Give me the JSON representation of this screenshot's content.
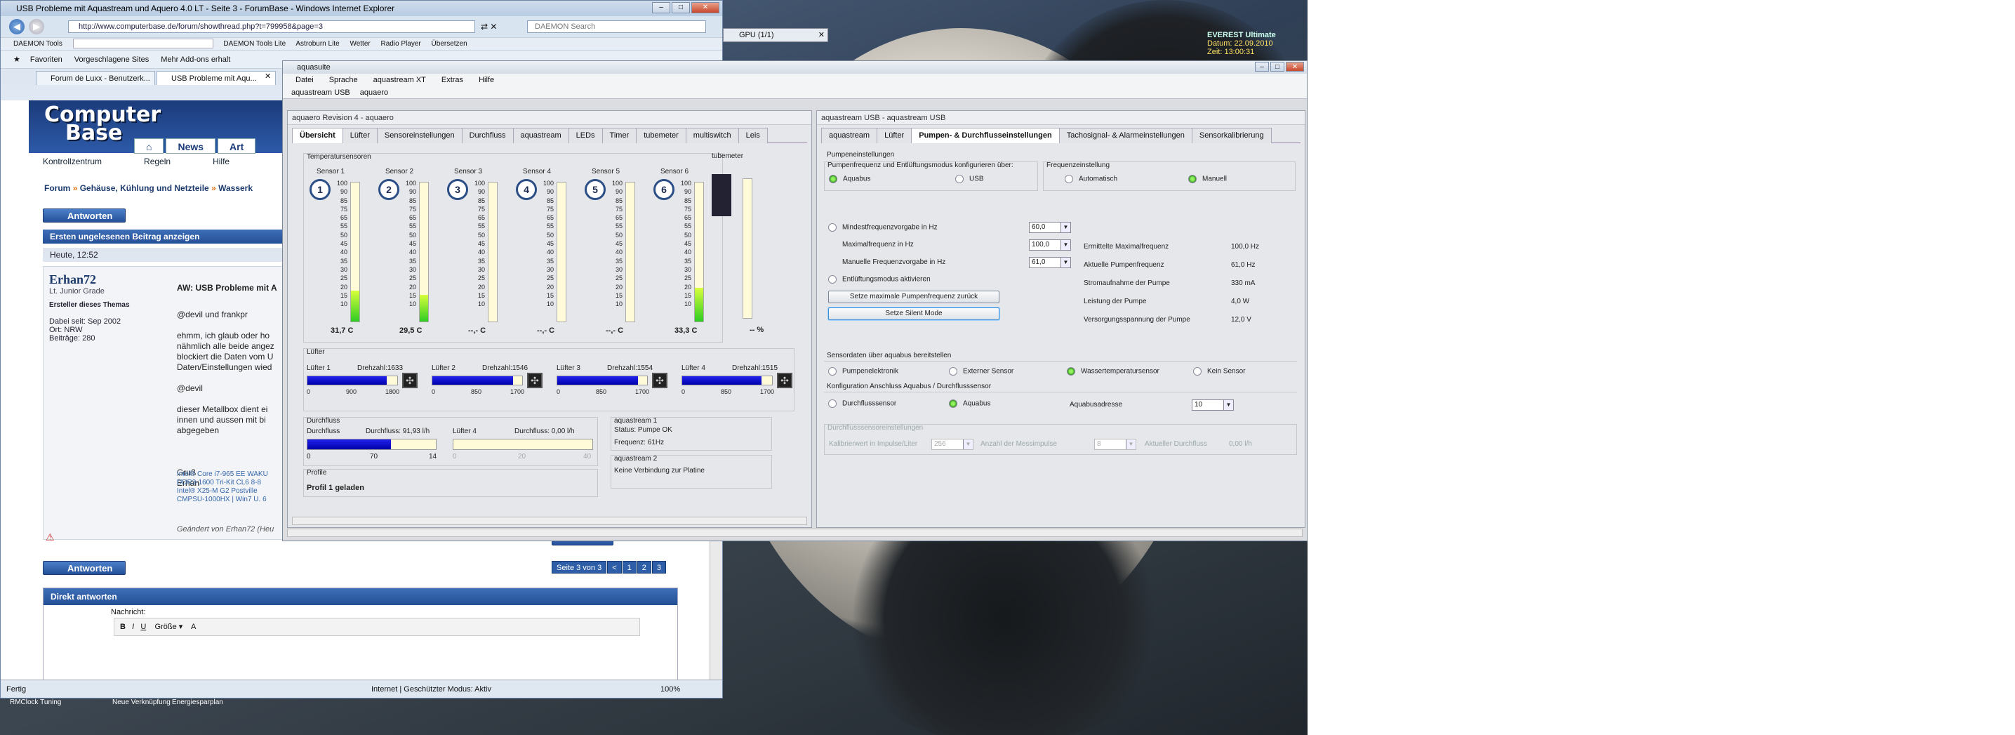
{
  "desktop": {
    "everest": {
      "title": "EVEREST Ultimate",
      "date": "Datum: 22.09.2010",
      "time": "Zeit: 13:00:31"
    },
    "icons": [
      "RMClock Tuning",
      "Neue Verknüpfung",
      "Energiesparplan"
    ]
  },
  "ie": {
    "title": "USB Probleme mit Aquastream und Aquero 4.0 LT - Seite 3 - ForumBase - Windows Internet Explorer",
    "url": "http://www.computerbase.de/forum/showthread.php?t=799958&page=3",
    "search_placeholder": "DAEMON Search",
    "toolbar": [
      "DAEMON Tools",
      "DAEMON Tools Lite",
      "Astroburn Lite",
      "Wetter",
      "Radio Player",
      "Übersetzen"
    ],
    "favorites": [
      "Favoriten",
      "Vorgeschlagene Sites",
      "Mehr Add-ons erhalt"
    ],
    "tabs": [
      "Forum de Luxx - Benutzerk...",
      "USB Probleme mit Aqu..."
    ],
    "status_left": "Fertig",
    "status_zone": "Internet | Geschützter Modus: Aktiv",
    "zoom": "100%"
  },
  "forum": {
    "logo_line1": "Computer",
    "logo_line2": "Base",
    "nav": [
      "News",
      "Art"
    ],
    "subnav": [
      "Kontrollzentrum",
      "Regeln",
      "Hilfe"
    ],
    "breadcrumb_a": "Forum",
    "breadcrumb_b": "Gehäuse, Kühlung und Netzteile",
    "breadcrumb_c": "Wasserk",
    "reply_btn": "Antworten",
    "first_unread": "Ersten ungelesenen Beitrag anzeigen",
    "post_time": "Heute, 12:52",
    "user": {
      "name": "Erhan72",
      "rank": "Lt. Junior Grade",
      "role": "Ersteller dieses Themas",
      "since": "Dabei seit: Sep 2002",
      "place": "Ort: NRW",
      "posts": "Beiträge: 280"
    },
    "post_title": "AW: USB Probleme mit A",
    "post_body": "@devil und frankpr\n\nehmm, ich glaub oder ho\nnähmlich alle beide angez\nblockiert die Daten vom U\nDaten/Einstellungen wied\n\n@devil\n\ndieser Metallbox dient ei\ninnen und aussen mit bi\nabgegeben",
    "greet": "Gruß\nErhan",
    "signature": "Intel® Core i7-965 EE WAKU\nDDR3-1600 Tri-Kit CL6 8-8\n Intel® X25-M G2 Postville\nCMPSU-1000HX | Win7 U. 6",
    "edited": "Geändert von Erhan72 (Heu",
    "page_info": "Seite 3 von 3",
    "pages": [
      "<",
      "1",
      "2",
      "3"
    ],
    "antwort": "Antwort",
    "direct_reply": "Direkt antworten",
    "message_label": "Nachricht:",
    "size_label": "Größe"
  },
  "aq": {
    "title": "aquasuite",
    "menu": [
      "Datei",
      "Sprache",
      "aquastream XT",
      "Extras",
      "Hilfe"
    ],
    "devices": [
      "aquastream USB",
      "aquaero"
    ],
    "left": {
      "title": "aquaero Revision 4 - aquaero",
      "tabs": [
        "Übersicht",
        "Lüfter",
        "Sensoreinstellungen",
        "Durchfluss",
        "aquastream",
        "LEDs",
        "Timer",
        "tubemeter",
        "multiswitch",
        "Leis"
      ],
      "temp_title": "Temperatursensoren",
      "tube_title": "tubemeter",
      "scale": [
        "100",
        "90",
        "85",
        "75",
        "65",
        "55",
        "50",
        "45",
        "40",
        "35",
        "30",
        "25",
        "20",
        "15",
        "10"
      ],
      "sensors": [
        {
          "name": "Sensor 1",
          "num": "1",
          "value": "31,7 C",
          "fill": 0.22
        },
        {
          "name": "Sensor 2",
          "num": "2",
          "value": "29,5 C",
          "fill": 0.19
        },
        {
          "name": "Sensor 3",
          "num": "3",
          "value": "--,- C",
          "fill": 0
        },
        {
          "name": "Sensor 4",
          "num": "4",
          "value": "--,- C",
          "fill": 0
        },
        {
          "name": "Sensor 5",
          "num": "5",
          "value": "--,- C",
          "fill": 0
        },
        {
          "name": "Sensor 6",
          "num": "6",
          "value": "33,3 C",
          "fill": 0.24
        }
      ],
      "tube_value": "-- %",
      "fans_title": "Lüfter",
      "fans": [
        {
          "name": "Lüfter 1",
          "rpm": "Drehzahl:1633",
          "ticks": [
            "0",
            "900",
            "1800"
          ],
          "fill": 0.88
        },
        {
          "name": "Lüfter 2",
          "rpm": "Drehzahl:1546",
          "ticks": [
            "0",
            "850",
            "1700"
          ],
          "fill": 0.9
        },
        {
          "name": "Lüfter 3",
          "rpm": "Drehzahl:1554",
          "ticks": [
            "0",
            "850",
            "1700"
          ],
          "fill": 0.9
        },
        {
          "name": "Lüfter 4",
          "rpm": "Drehzahl:1515",
          "ticks": [
            "0",
            "850",
            "1700"
          ],
          "fill": 0.88
        }
      ],
      "flow_title": "Durchfluss",
      "flow_name": "Durchfluss",
      "flow_value": "Durchfluss: 91,93 l/h",
      "flow_ticks": [
        "0",
        "70",
        "14"
      ],
      "flow_fill": 0.65,
      "flow4_name": "Lüfter 4",
      "flow4_value": "Durchfluss: 0,00 l/h",
      "flow4_ticks": [
        "0",
        "20",
        "40"
      ],
      "as1_title": "aquastream 1",
      "as1_status": "Status: Pumpe OK",
      "as1_freq": "Frequenz: 61Hz",
      "as2_title": "aquastream 2",
      "as2_status": "Keine Verbindung zur Platine",
      "profile_title": "Profile",
      "profile_value": "Profil 1 geladen"
    },
    "right": {
      "title": "aquastream USB - aquastream USB",
      "tabs": [
        "aquastream",
        "Lüfter",
        "Pumpen- & Durchflusseinstellungen",
        "Tachosignal- & Alarmeinstellungen",
        "Sensorkalibrierung"
      ],
      "pump_title": "Pumpeneinstellungen",
      "pump_mode_label": "Pumpenfrequenz und Entlüftungsmodus konfigurieren über:",
      "opt_aquabus": "Aquabus",
      "opt_usb": "USB",
      "freq_label": "Frequenzeinstellung",
      "opt_auto": "Automatisch",
      "opt_manual": "Manuell",
      "min_label": "Mindestfrequenzvorgabe in Hz",
      "min_val": "60,0",
      "max_label": "Maximalfrequenz in Hz",
      "max_val": "100,0",
      "man_label": "Manuelle Frequenzvorgabe in Hz",
      "man_val": "61,0",
      "vent_label": "Entlüftungsmodus aktivieren",
      "btn_reset": "Setze maximale Pumpenfrequenz zurück",
      "btn_silent": "Setze Silent Mode",
      "stats": [
        {
          "k": "Ermittelte Maximalfrequenz",
          "v": "100,0 Hz"
        },
        {
          "k": "Aktuelle Pumpenfrequenz",
          "v": "61,0 Hz"
        },
        {
          "k": "Stromaufnahme der Pumpe",
          "v": "330 mA"
        },
        {
          "k": "Leistung der Pumpe",
          "v": "4,0 W"
        },
        {
          "k": "Versorgungsspannung der Pumpe",
          "v": "12,0 V"
        }
      ],
      "sensor_title": "Sensordaten über aquabus bereitstellen",
      "sensor_opts": [
        "Pumpenelektronik",
        "Externer Sensor",
        "Wassertemperatursensor",
        "Kein Sensor"
      ],
      "conn_title": "Konfiguration Anschluss Aquabus / Durchflusssensor",
      "conn_opts": [
        "Durchflusssensor",
        "Aquabus"
      ],
      "addr_label": "Aquabusadresse",
      "addr_val": "10",
      "flow_title": "Durchflusssensoreinstellungen",
      "calib_label": "Kalibrierwert in Impulse/Liter",
      "calib_val": "256",
      "count_label": "Anzahl der Messimpulse",
      "count_val": "8",
      "cur_label": "Aktueller Durchfluss",
      "cur_val": "0,00 l/h"
    }
  },
  "gpu_tab": "GPU (1/1)"
}
